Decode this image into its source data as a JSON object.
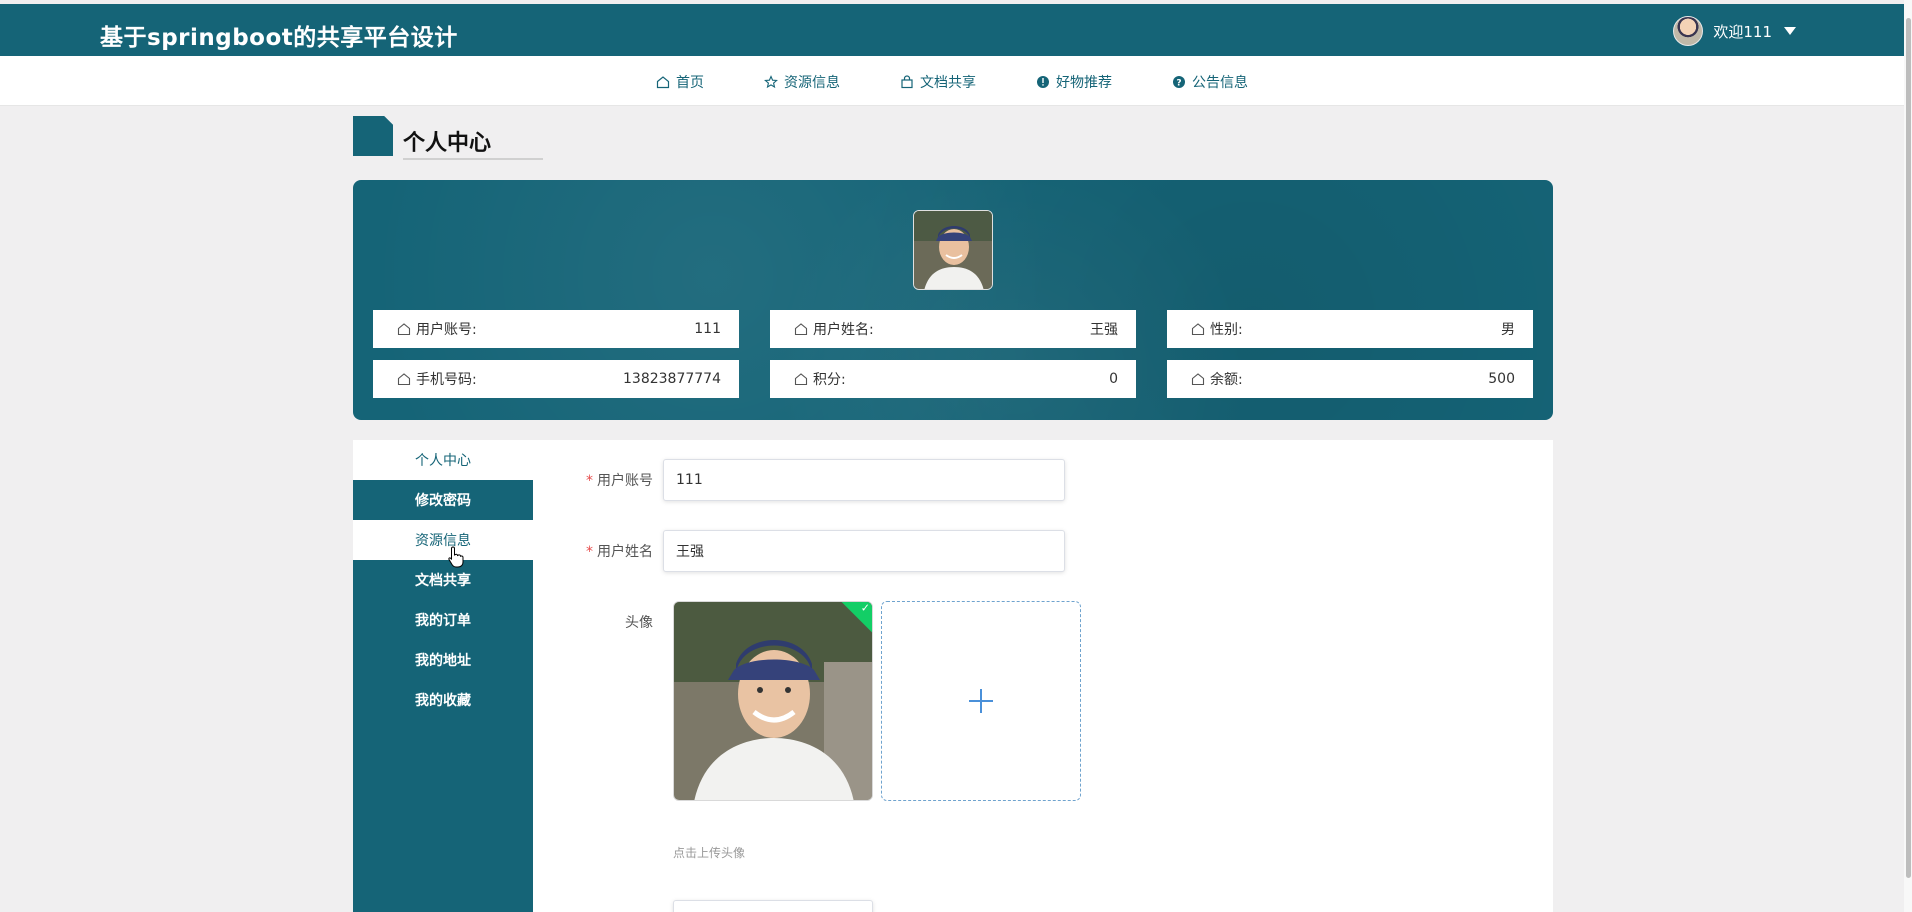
{
  "header": {
    "site_title": "基于springboot的共享平台设计",
    "welcome": "欢迎111"
  },
  "nav": {
    "items": [
      {
        "label": "首页",
        "icon": "home-icon"
      },
      {
        "label": "资源信息",
        "icon": "star-icon"
      },
      {
        "label": "文档共享",
        "icon": "bag-icon"
      },
      {
        "label": "好物推荐",
        "icon": "info-icon"
      },
      {
        "label": "公告信息",
        "icon": "question-icon"
      }
    ]
  },
  "page": {
    "title": "个人中心"
  },
  "profile": {
    "fields": [
      {
        "label": "用户账号:",
        "value": "111"
      },
      {
        "label": "用户姓名:",
        "value": "王强"
      },
      {
        "label": "性别:",
        "value": "男"
      },
      {
        "label": "手机号码:",
        "value": "13823877774"
      },
      {
        "label": "积分:",
        "value": "0"
      },
      {
        "label": "余额:",
        "value": "500"
      }
    ]
  },
  "side_menu": {
    "items": [
      "个人中心",
      "修改密码",
      "资源信息",
      "文档共享",
      "我的订单",
      "我的地址",
      "我的收藏"
    ]
  },
  "form": {
    "account_label": "用户账号",
    "account_value": "111",
    "name_label": "用户姓名",
    "name_value": "王强",
    "avatar_label": "头像",
    "upload_tip": "点击上传头像"
  },
  "colors": {
    "primary": "#156477",
    "required": "#e64c4c",
    "success": "#13ce66"
  }
}
